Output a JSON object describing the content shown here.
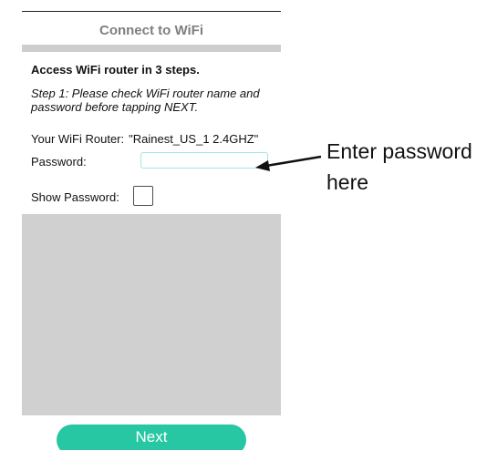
{
  "header": {
    "title": "Connect to WiFi"
  },
  "instructions": {
    "steps_title": "Access WiFi router in 3 steps.",
    "step1": "Step 1: Please check WiFi router name and password before tapping NEXT."
  },
  "router": {
    "label": "Your WiFi Router:",
    "name": "\"Rainest_US_1 2.4GHZ\""
  },
  "password": {
    "label": "Password:",
    "value": "",
    "placeholder": ""
  },
  "show_password": {
    "label": "Show Password:",
    "checked": false
  },
  "next_button": {
    "label": "Next"
  },
  "annotation": {
    "text": "Enter password here"
  },
  "colors": {
    "accent": "#27c7a4",
    "input_border": "#9fe7e2",
    "header_text": "#7f7f7f",
    "panel_gray": "#d0d0d0"
  }
}
